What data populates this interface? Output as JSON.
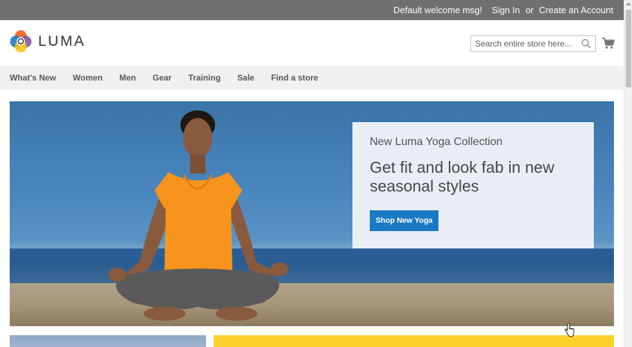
{
  "top_panel": {
    "welcome": "Default welcome msg!",
    "sign_in": "Sign In",
    "or": "or",
    "create_account": "Create an Account"
  },
  "header": {
    "logo_text": "LUMA",
    "search_placeholder": "Search entire store here...",
    "icons": [
      "luma-logo-icon",
      "search-icon",
      "cart-icon"
    ]
  },
  "nav": {
    "items": [
      "What's New",
      "Women",
      "Men",
      "Gear",
      "Training",
      "Sale",
      "Find a store"
    ]
  },
  "hero": {
    "subtitle": "New Luma Yoga Collection",
    "title": "Get fit and look fab in new seasonal styles",
    "button": "Shop New Yoga"
  },
  "colors": {
    "top_panel": "#6e716e",
    "nav_bg": "#f0f0f0",
    "button": "#1979c3",
    "promo_box": "#e9eef4",
    "yellow_tile": "#fbd22c"
  }
}
